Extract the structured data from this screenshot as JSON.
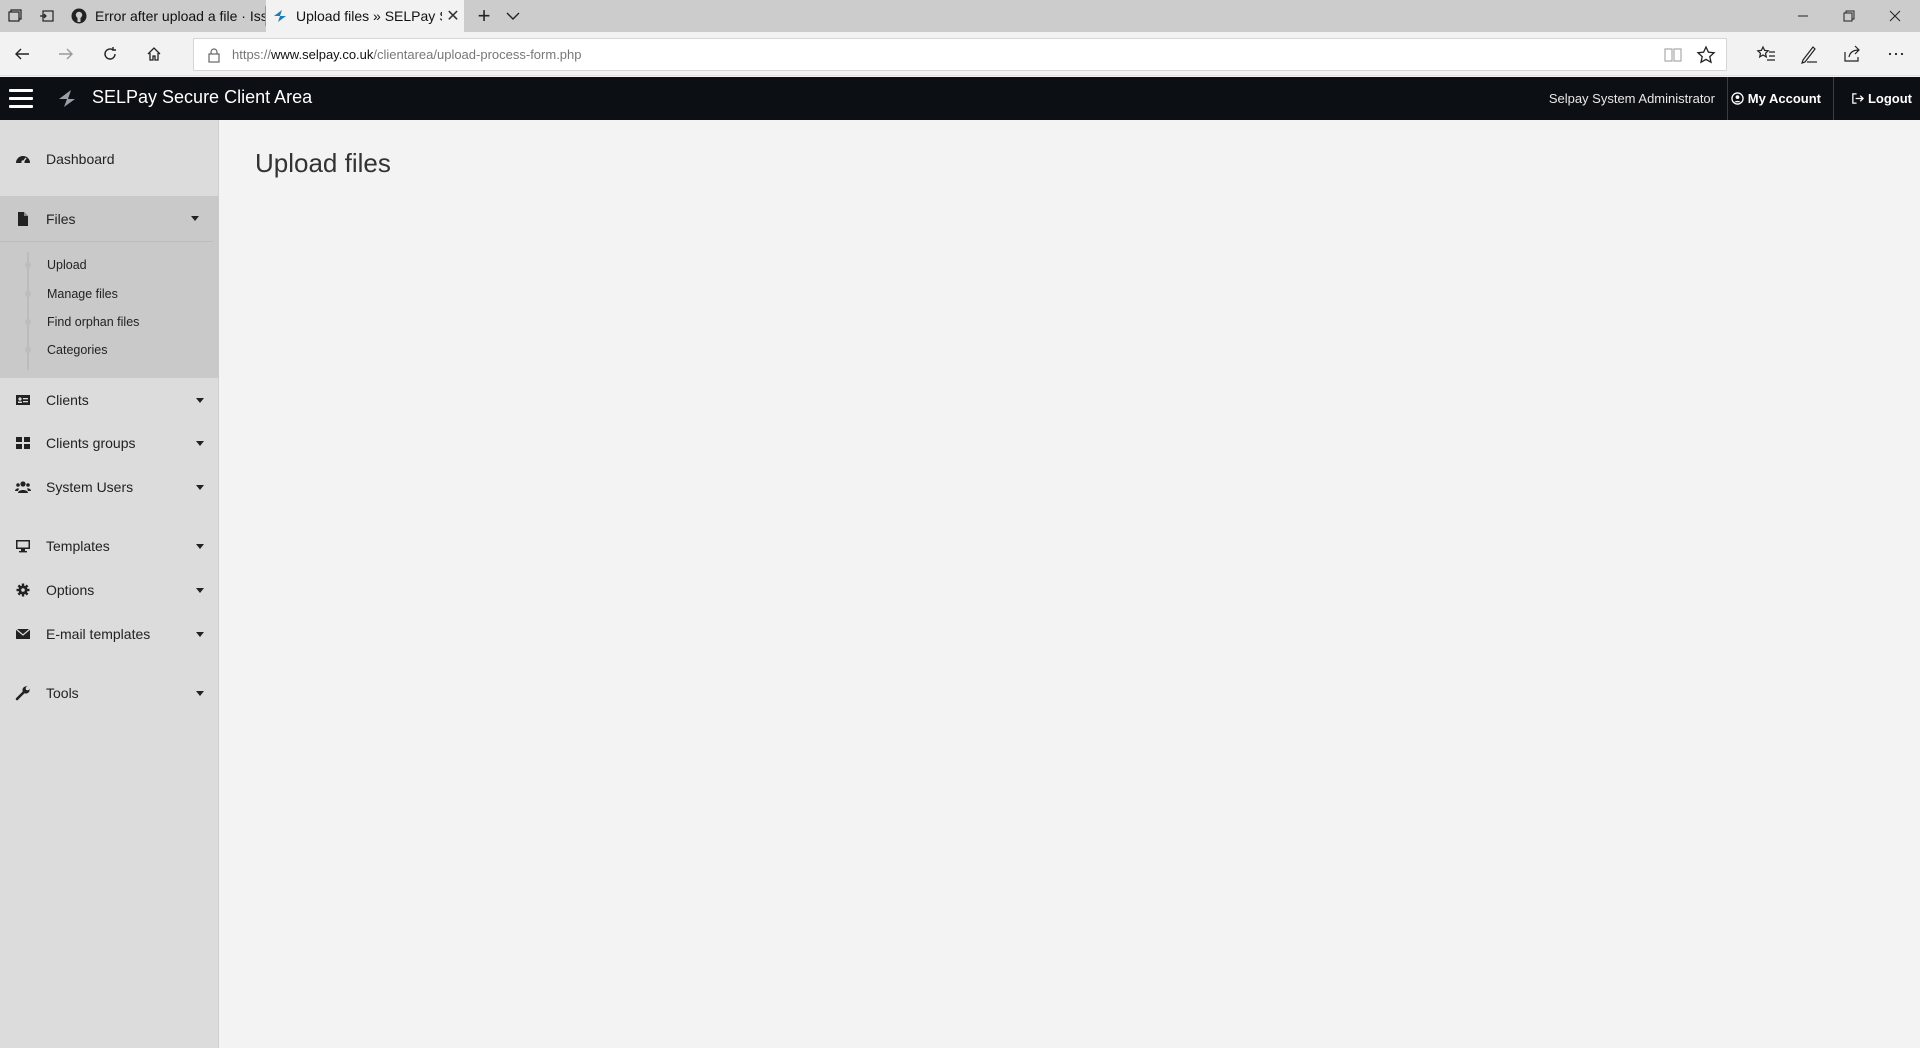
{
  "browser": {
    "tabs": [
      {
        "title": "Error after upload a file · Issu",
        "favicon": "github-icon",
        "active": false
      },
      {
        "title": "Upload files » SELPay Se",
        "favicon": "selpay-icon",
        "active": true
      }
    ],
    "address": {
      "scheme": "https://",
      "domain": "www.selpay.co.uk",
      "path": "/clientarea/upload-process-form.php"
    },
    "window_controls": [
      "minimize",
      "restore",
      "close"
    ]
  },
  "app": {
    "title": "SELPay Secure Client Area",
    "user_name": "Selpay System Administrator",
    "my_account_label": "My Account",
    "logout_label": "Logout",
    "header_bg": "#0c0f14",
    "accent_color": "#1b55a2"
  },
  "sidebar": {
    "items": [
      {
        "label": "Dashboard",
        "icon": "dashboard-icon",
        "has_caret": false
      },
      {
        "label": "Files",
        "icon": "file-icon",
        "has_caret": true,
        "expanded": true
      },
      {
        "label": "Clients",
        "icon": "id-card-icon",
        "has_caret": true
      },
      {
        "label": "Clients groups",
        "icon": "grid-icon",
        "has_caret": true
      },
      {
        "label": "System Users",
        "icon": "users-icon",
        "has_caret": true
      },
      {
        "label": "Templates",
        "icon": "monitor-icon",
        "has_caret": true
      },
      {
        "label": "Options",
        "icon": "gear-icon",
        "has_caret": true
      },
      {
        "label": "E-mail templates",
        "icon": "envelope-icon",
        "has_caret": true
      },
      {
        "label": "Tools",
        "icon": "wrench-icon",
        "has_caret": true
      }
    ],
    "files_subitems": [
      "Upload",
      "Manage files",
      "Find orphan files",
      "Categories"
    ]
  },
  "main": {
    "page_title": "Upload files"
  }
}
